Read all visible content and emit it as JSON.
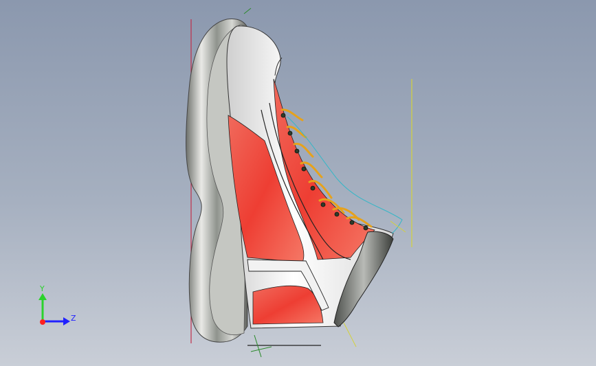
{
  "triad": {
    "y_label": "Y",
    "z_label": "Z",
    "colors": {
      "y": "#2bd22b",
      "z": "#2020ff",
      "x": "#ff2020"
    }
  },
  "model": {
    "colors": {
      "red": "#ef4a3e",
      "red_light": "#f97b68",
      "white": "#f4f4f4",
      "gray": "#9a9d98",
      "lace": "#e6a21c"
    }
  }
}
